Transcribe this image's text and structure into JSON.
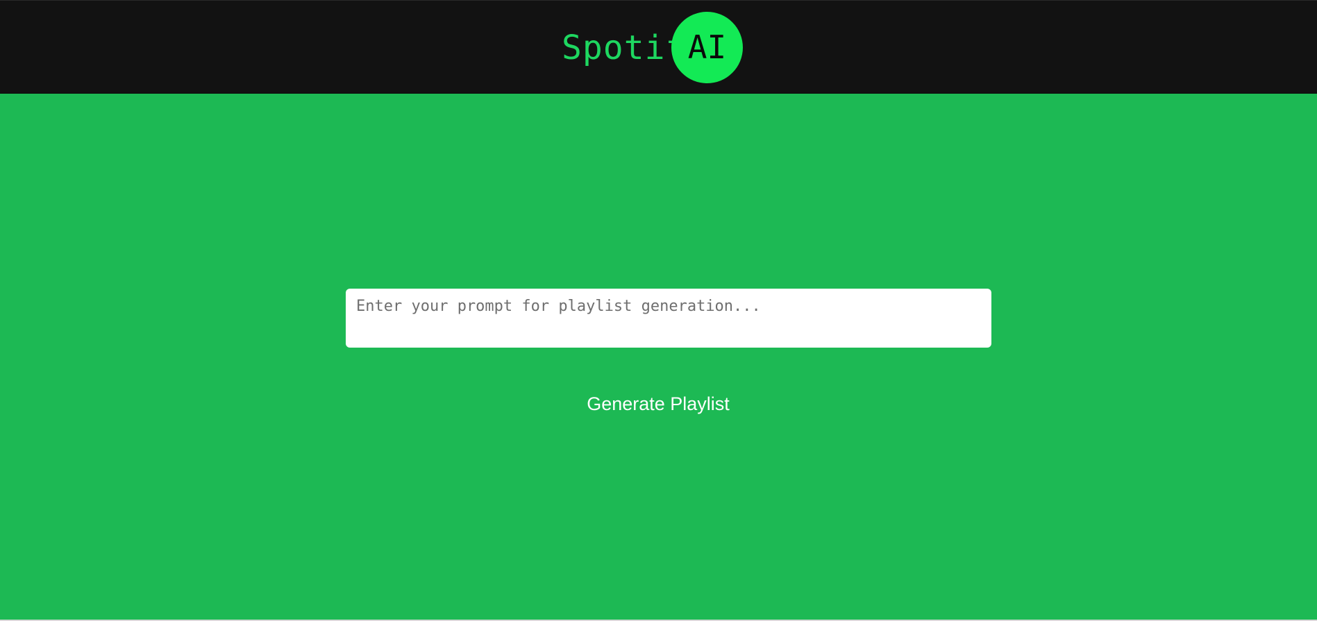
{
  "header": {
    "logo": {
      "text": "Spotif",
      "badge_text": "AI"
    }
  },
  "main": {
    "prompt": {
      "placeholder": "Enter your prompt for playlist generation...",
      "value": ""
    },
    "generate_button_label": "Generate Playlist"
  },
  "colors": {
    "header_background": "#121212",
    "page_background": "#1db954",
    "logo_text": "#1ed760",
    "logo_badge": "#13ea55",
    "button_text": "#ffffff",
    "input_background": "#ffffff"
  }
}
